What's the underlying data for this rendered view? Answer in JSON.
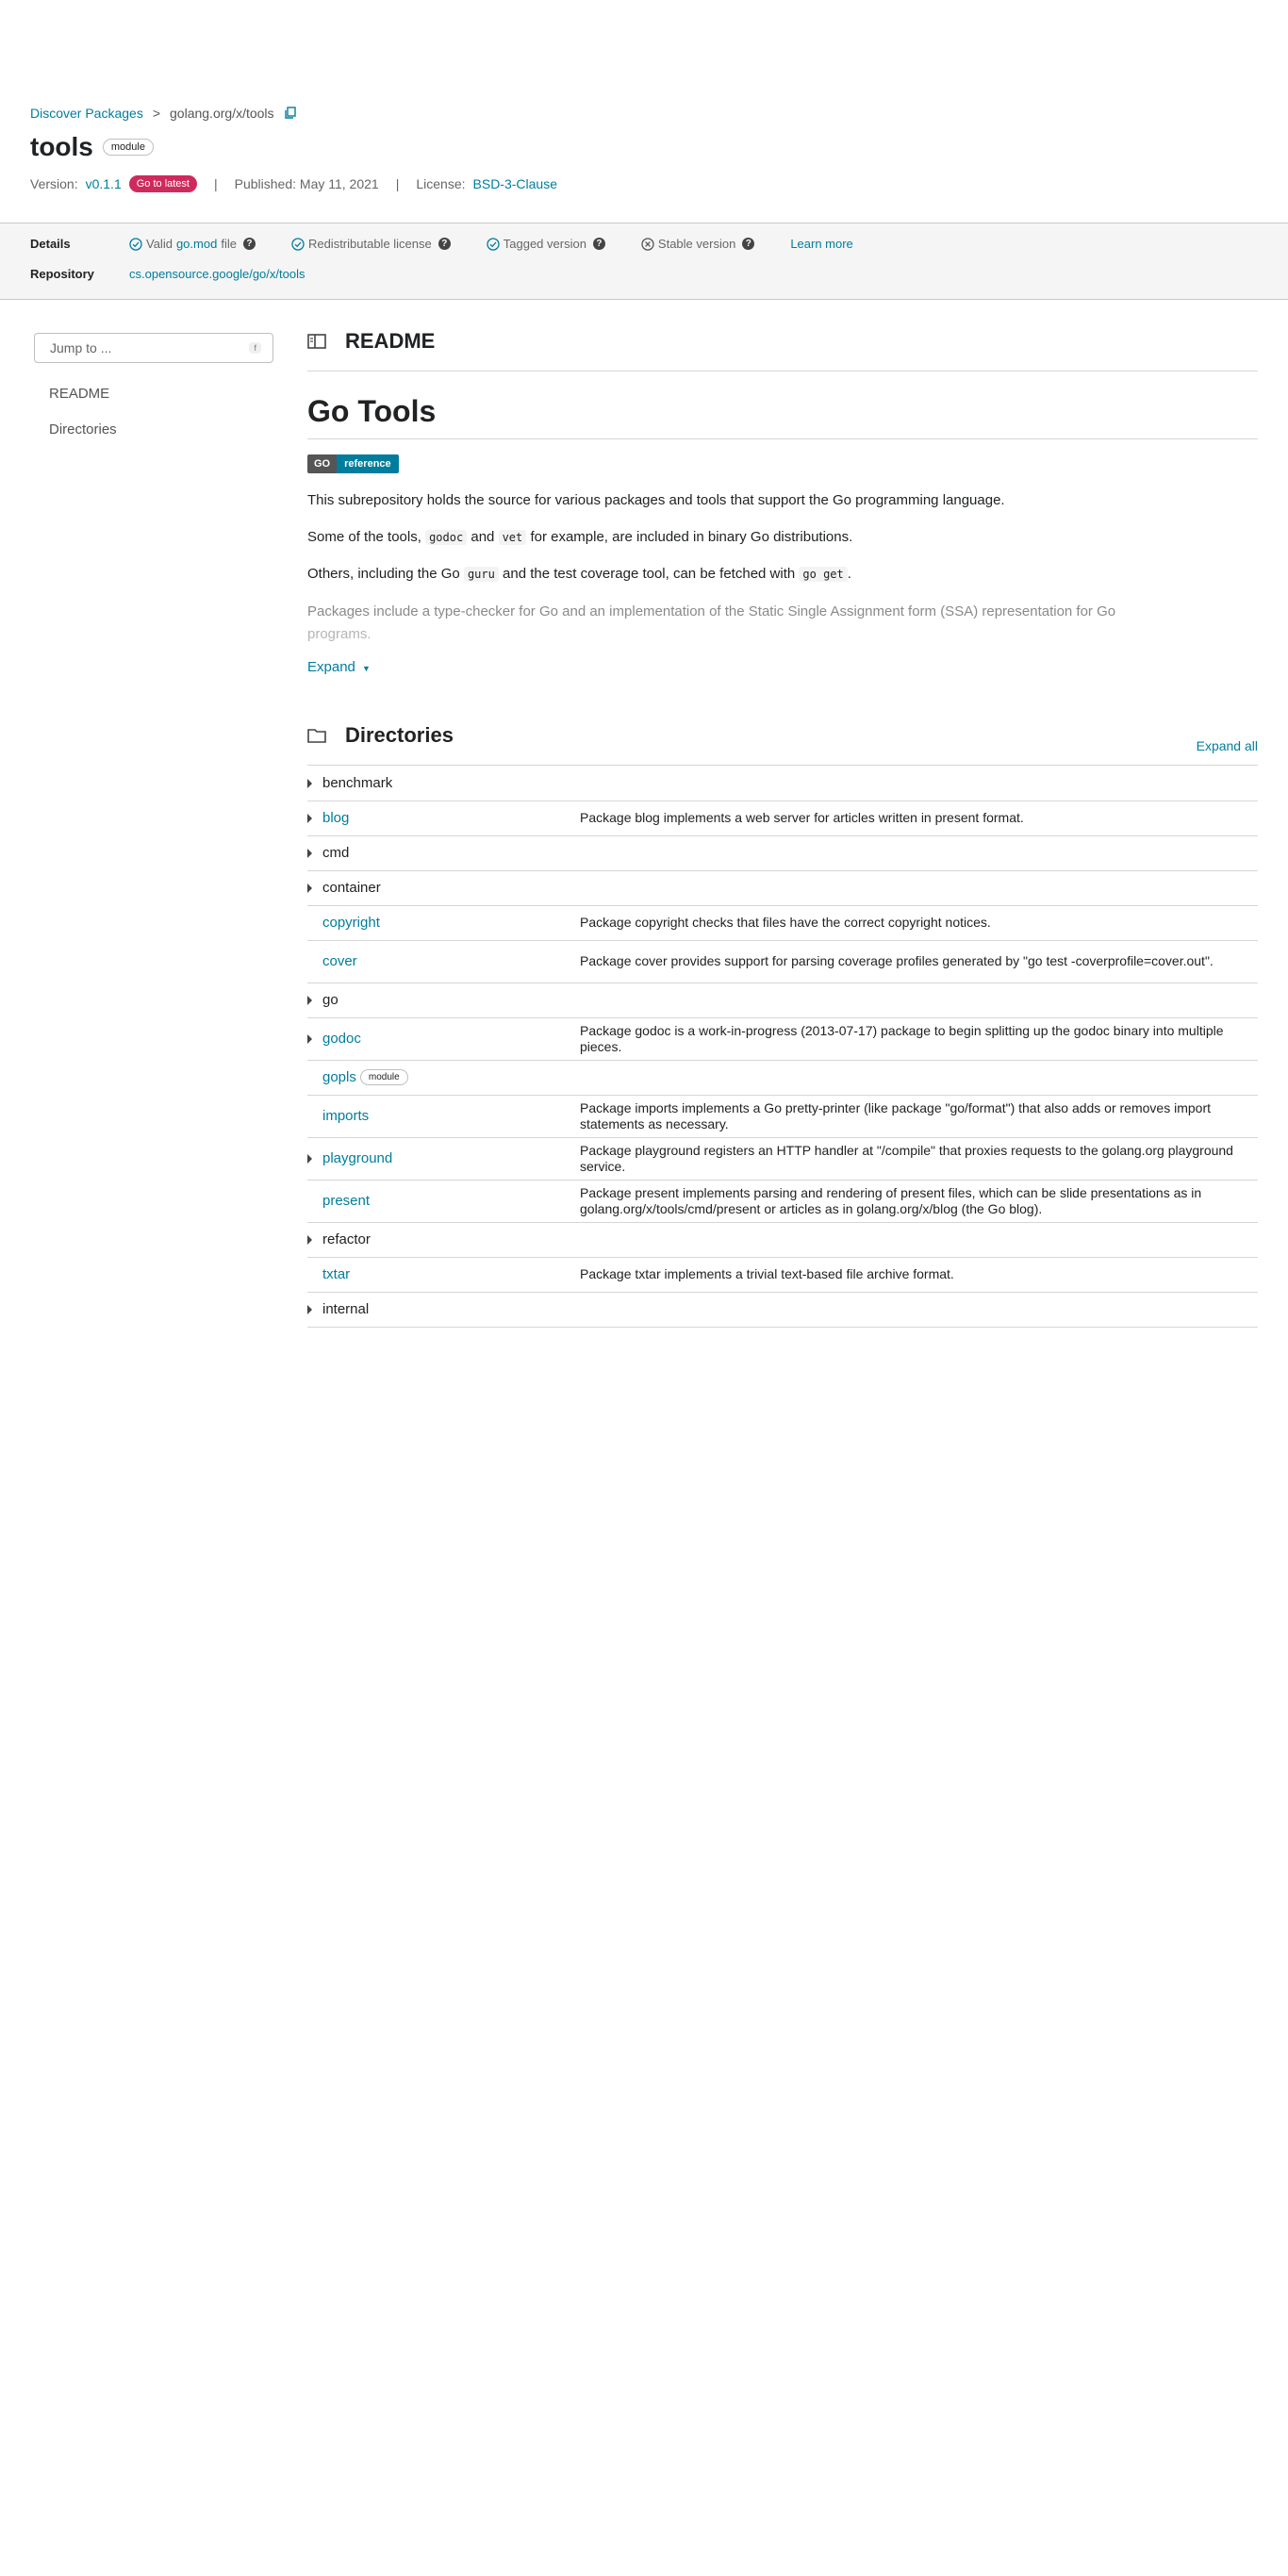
{
  "breadcrumb": {
    "root": "Discover Packages",
    "separator": ">",
    "current": "golang.org/x/tools"
  },
  "title": "tools",
  "title_chip": "module",
  "meta": {
    "version_label": "Version:",
    "version": "v0.1.1",
    "latest_badge": "Go to latest",
    "published": "Published: May 11, 2021",
    "license_label": "License:",
    "license": "BSD-3-Clause",
    "divider": "|"
  },
  "details": {
    "label": "Details",
    "valid_prefix": "Valid",
    "valid_link": "go.mod",
    "valid_suffix": "file",
    "redistributable": "Redistributable license",
    "tagged": "Tagged version",
    "stable": "Stable version",
    "learn_more": "Learn more",
    "help": "?"
  },
  "repository": {
    "label": "Repository",
    "url": "cs.opensource.google/go/x/tools"
  },
  "sidebar": {
    "jump_placeholder": "Jump to ...",
    "jump_key": "f",
    "items": [
      "README",
      "Directories"
    ]
  },
  "readme": {
    "heading": "README",
    "h1": "Go Tools",
    "badge_left": "GO",
    "badge_right": "reference",
    "p1": "This subrepository holds the source for various packages and tools that support the Go programming language.",
    "p2_a": "Some of the tools,",
    "p2_code1": "godoc",
    "p2_b": "and",
    "p2_code2": "vet",
    "p2_c": "for example, are included in binary Go distributions.",
    "p3_a": "Others, including the Go",
    "p3_code1": "guru",
    "p3_b": "and the test coverage tool, can be fetched with",
    "p3_code2": "go get",
    "p3_c": ".",
    "p4_line1": "Packages include a type-checker for Go and an implementation of the Static Single Assignment form (SSA) representation for Go",
    "p4_line2": "programs.",
    "expand": "Expand"
  },
  "directories": {
    "heading": "Directories",
    "expand_all": "Expand all",
    "rows": [
      {
        "name": "benchmark",
        "expandable": true,
        "link": false,
        "desc": "",
        "chip": ""
      },
      {
        "name": "blog",
        "expandable": true,
        "link": true,
        "desc": "Package blog implements a web server for articles written in present format.",
        "chip": ""
      },
      {
        "name": "cmd",
        "expandable": true,
        "link": false,
        "desc": "",
        "chip": ""
      },
      {
        "name": "container",
        "expandable": true,
        "link": false,
        "desc": "",
        "chip": ""
      },
      {
        "name": "copyright",
        "expandable": false,
        "link": true,
        "desc": "Package copyright checks that files have the correct copyright notices.",
        "chip": ""
      },
      {
        "name": "cover",
        "expandable": false,
        "link": true,
        "desc": "Package cover provides support for parsing coverage profiles generated by \"go test -coverprofile=cover.out\".",
        "chip": ""
      },
      {
        "name": "go",
        "expandable": true,
        "link": false,
        "desc": "",
        "chip": ""
      },
      {
        "name": "godoc",
        "expandable": true,
        "link": true,
        "desc": "Package godoc is a work-in-progress (2013-07-17) package to begin splitting up the godoc binary into multiple pieces.",
        "chip": ""
      },
      {
        "name": "gopls",
        "expandable": false,
        "link": true,
        "desc": "",
        "chip": "module"
      },
      {
        "name": "imports",
        "expandable": false,
        "link": true,
        "desc": "Package imports implements a Go pretty-printer (like package \"go/format\") that also adds or removes import statements as necessary.",
        "chip": ""
      },
      {
        "name": "playground",
        "expandable": true,
        "link": true,
        "desc": "Package playground registers an HTTP handler at \"/compile\" that proxies requests to the golang.org playground service.",
        "chip": ""
      },
      {
        "name": "present",
        "expandable": false,
        "link": true,
        "desc": "Package present implements parsing and rendering of present files, which can be slide presentations as in golang.org/x/tools/cmd/present or articles as in golang.org/x/blog (the Go blog).",
        "chip": ""
      },
      {
        "name": "refactor",
        "expandable": true,
        "link": false,
        "desc": "",
        "chip": ""
      },
      {
        "name": "txtar",
        "expandable": false,
        "link": true,
        "desc": "Package txtar implements a trivial text-based file archive format.",
        "chip": ""
      },
      {
        "name": "internal",
        "expandable": true,
        "link": false,
        "desc": "",
        "chip": ""
      }
    ]
  },
  "colors": {
    "link": "#007d9c",
    "latest_badge": "#cf2a5d",
    "details_band": "#f5f5f5"
  }
}
